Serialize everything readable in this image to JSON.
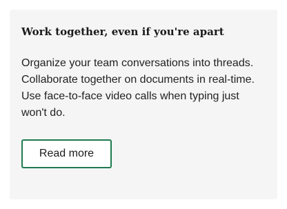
{
  "card": {
    "title": "Work together, even if you're apart",
    "body": "Organize your team conversations into threads. Collaborate together on documents in real-time. Use face-to-face video calls when typing just won't do.",
    "button_label": "Read more"
  },
  "colors": {
    "card_background": "#f5f5f5",
    "button_border": "#1e7a4f"
  }
}
